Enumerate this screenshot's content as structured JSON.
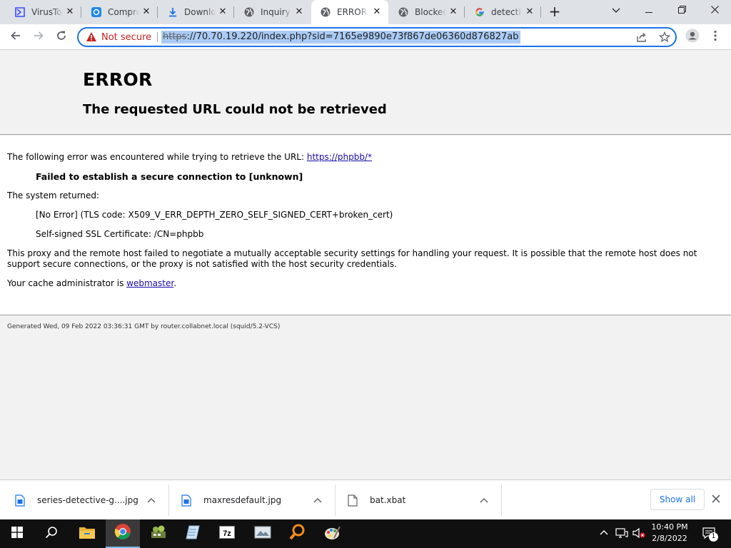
{
  "browser": {
    "tabs": [
      {
        "title": "VirusTotal",
        "favicon": "virustotal-icon",
        "active": false
      },
      {
        "title": "Compre",
        "favicon": "shield-icon",
        "active": false
      },
      {
        "title": "Downlo",
        "favicon": "download-icon",
        "active": false
      },
      {
        "title": "Inquiry",
        "favicon": "globe-icon",
        "active": false
      },
      {
        "title": "ERROR:",
        "favicon": "globe-icon",
        "active": true
      },
      {
        "title": "Blocked",
        "favicon": "globe-icon",
        "active": false
      },
      {
        "title": "detectiv",
        "favicon": "google-icon",
        "active": false
      }
    ],
    "new_tab_symbol": "+",
    "address_bar": {
      "security_label": "Not secure",
      "scheme": "https",
      "url_rest": "://70.70.19.220/index.php?sid=7165e9890e73f867de06360d876827ab"
    }
  },
  "page": {
    "heading": "ERROR",
    "subheading": "The requested URL could not be retrieved",
    "intro_text": "The following error was encountered while trying to retrieve the URL: ",
    "intro_link": "https://phpbb/*",
    "error_title": "Failed to establish a secure connection to [unknown]",
    "system_returned_label": "The system returned:",
    "system_error": "[No Error] (TLS code: X509_V_ERR_DEPTH_ZERO_SELF_SIGNED_CERT+broken_cert)",
    "cert_info": "Self-signed SSL Certificate: /CN=phpbb",
    "explanation_line1": "This proxy and the remote host failed to negotiate a mutually acceptable security settings for handling your request. It is possible that the remote host does not",
    "explanation_line2": "support secure connections, or the proxy is not satisfied with the host security credentials.",
    "admin_text": "Your cache administrator is ",
    "admin_link": "webmaster",
    "admin_suffix": ".",
    "footer": "Generated Wed, 09 Feb 2022 03:36:31 GMT by router.collabnet.local (squid/5.2-VCS)"
  },
  "downloads": {
    "items": [
      {
        "name": "series-detective-g....jpg",
        "icon": "image-file-icon"
      },
      {
        "name": "maxresdefault.jpg",
        "icon": "image-file-icon"
      },
      {
        "name": "bat.xbat",
        "icon": "file-icon"
      }
    ],
    "show_all": "Show all"
  },
  "taskbar": {
    "apps": [
      "start-icon",
      "search-icon",
      "file-explorer-icon",
      "chrome-icon",
      "network-tool-icon",
      "notepad-icon",
      "7zip-icon",
      "image-viewer-icon",
      "magnifier-icon",
      "paint-icon"
    ],
    "time": "10:40 PM",
    "date": "2/8/2022",
    "notification_count": "1"
  },
  "colors": {
    "accent": "#1a73e8",
    "link": "#1a0dab",
    "warning": "#c5221f",
    "page_bg": "#f2f2f2"
  }
}
